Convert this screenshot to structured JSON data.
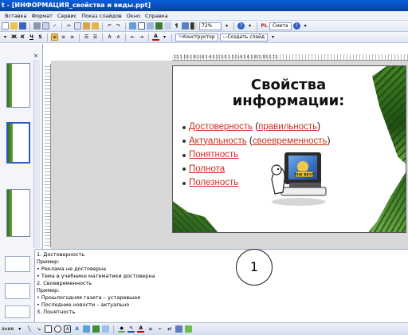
{
  "window": {
    "title": "t - [ИНФОРМАЦИЯ_свойства и виды.ppt]"
  },
  "menu": [
    "Вставка",
    "Формат",
    "Сервис",
    "Показ слайдов",
    "Окно",
    "Справка"
  ],
  "toolbar": {
    "zoom_value": "72%",
    "help_label": "Смета",
    "designer_label": "Конструктор",
    "new_slide_label": "Создать слайд",
    "ruler_text": "·12·1·10·1·8·1·6·1·4·1·2·1·0·1·2·1·4·1·6·1·8·1·10·1·12·"
  },
  "left_pane": {
    "close_glyph": "×"
  },
  "slide": {
    "title_line1": "Свойства",
    "title_line2": "информации:",
    "bullets": [
      {
        "parts": [
          {
            "t": "Достоверность",
            "link": true
          },
          {
            "t": " (",
            "link": false
          },
          {
            "t": "правильность",
            "link": true
          },
          {
            "t": ")",
            "link": false
          }
        ]
      },
      {
        "parts": [
          {
            "t": "Актуальность",
            "link": true
          },
          {
            "t": " (",
            "link": false
          },
          {
            "t": "своевременность",
            "link": true
          },
          {
            "t": ")",
            "link": false
          }
        ]
      },
      {
        "parts": [
          {
            "t": "Понятность",
            "link": true
          }
        ]
      },
      {
        "parts": [
          {
            "t": "Полнота",
            "link": true
          }
        ]
      },
      {
        "parts": [
          {
            "t": "Полезность",
            "link": true
          }
        ]
      }
    ],
    "clipart_label": "THE BEST"
  },
  "notes": {
    "lines": [
      {
        "text": "1. Достоверность",
        "bullet": false
      },
      {
        "text": "Пример:",
        "bullet": false
      },
      {
        "text": "Реклама не достоверна",
        "bullet": true
      },
      {
        "text": "Тема в учебнике математики достоверна",
        "bullet": true
      },
      {
        "text": "2. Своевременность",
        "bullet": false
      },
      {
        "text": "Пример:",
        "bullet": false
      },
      {
        "text": "Прошлогодняя газета – устаревшая",
        "bullet": true
      },
      {
        "text": "Последние новости – актуально",
        "bullet": true
      },
      {
        "text": "3. Понятность",
        "bullet": false
      }
    ],
    "callout_number": "1"
  },
  "drawbar": {
    "label": "ание"
  },
  "colors": {
    "link": "#c8321e",
    "titlebar": "#0a4fc4"
  }
}
